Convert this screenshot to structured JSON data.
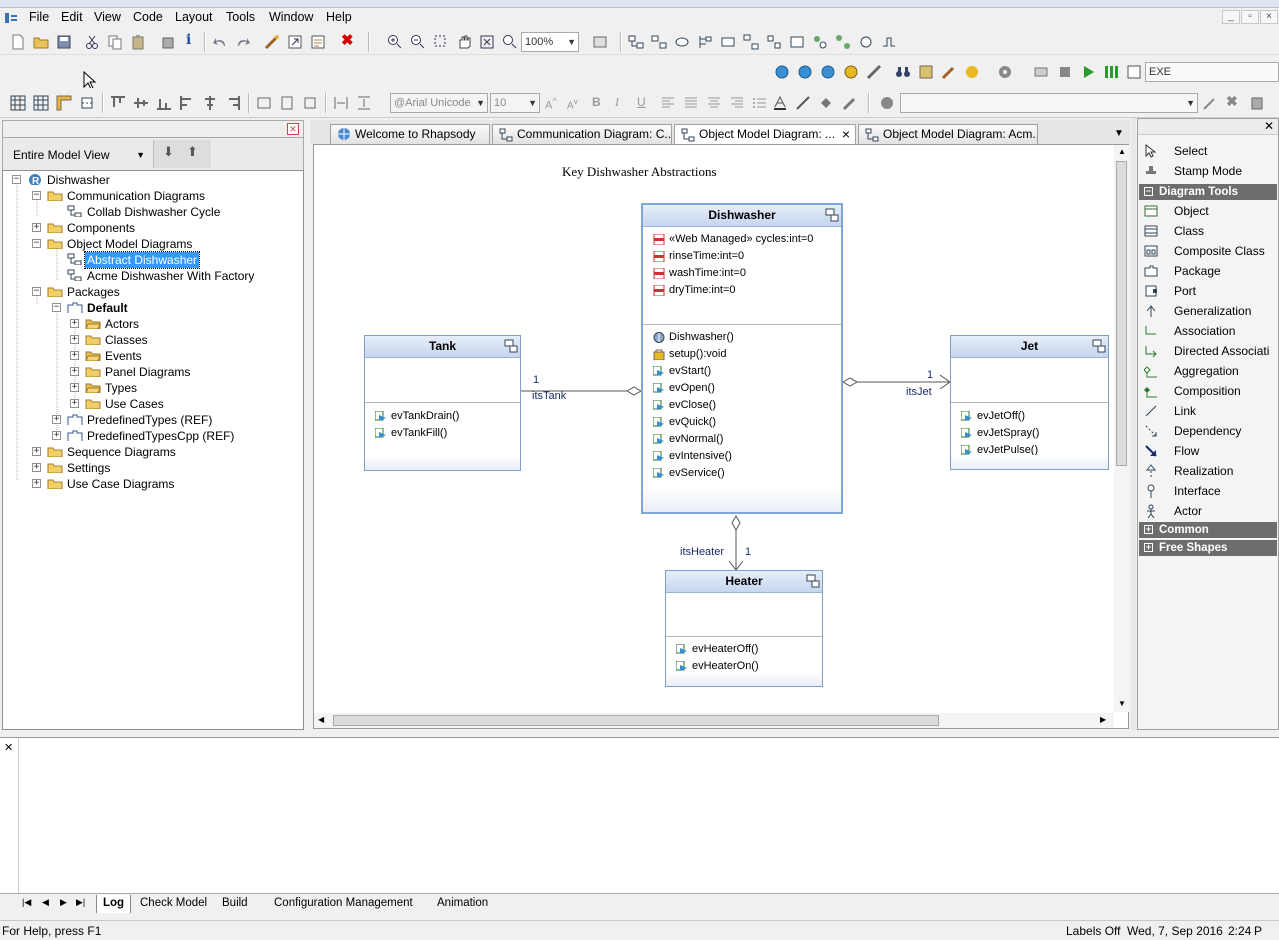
{
  "window": {
    "controls": [
      "_",
      "▫",
      "×"
    ]
  },
  "menu": [
    "File",
    "Edit",
    "View",
    "Code",
    "Layout",
    "Tools",
    "Window",
    "Help"
  ],
  "toolbar": {
    "zoom": "100%",
    "font": "@Arial Unicode",
    "font_size": "10",
    "config": "EXE"
  },
  "browser": {
    "view_selector": "Entire Model View",
    "tree": [
      {
        "label": "Dishwasher",
        "level": 0,
        "type": "root",
        "expanded": true
      },
      {
        "label": "Communication Diagrams",
        "level": 1,
        "type": "folder",
        "expanded": true
      },
      {
        "label": "Collab Dishwasher Cycle",
        "level": 2,
        "type": "diagram"
      },
      {
        "label": "Components",
        "level": 1,
        "type": "folder",
        "expanded": false
      },
      {
        "label": "Object Model Diagrams",
        "level": 1,
        "type": "folder",
        "expanded": true
      },
      {
        "label": "Abstract Dishwasher",
        "level": 2,
        "type": "diagram",
        "selected": true
      },
      {
        "label": "Acme Dishwasher With Factory",
        "level": 2,
        "type": "diagram"
      },
      {
        "label": "Packages",
        "level": 1,
        "type": "folder",
        "expanded": true
      },
      {
        "label": "Default",
        "level": 2,
        "type": "package",
        "expanded": true,
        "bold": true
      },
      {
        "label": "Actors",
        "level": 3,
        "type": "folder-open",
        "expanded": false
      },
      {
        "label": "Classes",
        "level": 3,
        "type": "folder",
        "expanded": false
      },
      {
        "label": "Events",
        "level": 3,
        "type": "folder-open",
        "expanded": false
      },
      {
        "label": "Panel Diagrams",
        "level": 3,
        "type": "folder",
        "expanded": false
      },
      {
        "label": "Types",
        "level": 3,
        "type": "folder-open",
        "expanded": false
      },
      {
        "label": "Use Cases",
        "level": 3,
        "type": "folder",
        "expanded": false
      },
      {
        "label": "PredefinedTypes (REF)",
        "level": 2,
        "type": "package",
        "expanded": false
      },
      {
        "label": "PredefinedTypesCpp (REF)",
        "level": 2,
        "type": "package",
        "expanded": false
      },
      {
        "label": "Sequence Diagrams",
        "level": 1,
        "type": "folder",
        "expanded": false
      },
      {
        "label": "Settings",
        "level": 1,
        "type": "folder",
        "expanded": false
      },
      {
        "label": "Use Case Diagrams",
        "level": 1,
        "type": "folder",
        "expanded": false
      }
    ]
  },
  "tabs": [
    {
      "label": "Welcome to Rhapsody",
      "active": false
    },
    {
      "label": "Communication Diagram: C...",
      "active": false
    },
    {
      "label": "Object Model Diagram: ...",
      "active": true,
      "close": "×"
    },
    {
      "label": "Object Model Diagram: Acm...",
      "active": false
    }
  ],
  "diagram": {
    "title": "Key Dishwasher Abstractions",
    "classes": {
      "dishwasher": {
        "name": "Dishwasher",
        "attributes": [
          "«Web Managed» cycles:int=0",
          "rinseTime:int=0",
          "washTime:int=0",
          "dryTime:int=0"
        ],
        "operations": [
          "Dishwasher()",
          "setup():void",
          "evStart()",
          "evOpen()",
          "evClose()",
          "evQuick()",
          "evNormal()",
          "evIntensive()",
          "evService()"
        ]
      },
      "tank": {
        "name": "Tank",
        "operations": [
          "evTankDrain()",
          "evTankFill()"
        ]
      },
      "jet": {
        "name": "Jet",
        "operations": [
          "evJetOff()",
          "evJetSpray()",
          "evJetPulse()"
        ]
      },
      "heater": {
        "name": "Heater",
        "operations": [
          "evHeaterOff()",
          "evHeaterOn()"
        ]
      }
    },
    "links": {
      "tank": {
        "mult": "1",
        "role": "itsTank"
      },
      "jet": {
        "mult": "1",
        "role": "itsJet"
      },
      "heater": {
        "mult": "1",
        "role": "itsHeater"
      }
    }
  },
  "palette": {
    "items": [
      "Select",
      "Stamp Mode"
    ],
    "sections": [
      {
        "title": "Diagram Tools",
        "expanded": true,
        "items": [
          "Object",
          "Class",
          "Composite Class",
          "Package",
          "Port",
          "Generalization",
          "Association",
          "Directed Associati",
          "Aggregation",
          "Composition",
          "Link",
          "Dependency",
          "Flow",
          "Realization",
          "Interface",
          "Actor"
        ]
      },
      {
        "title": "Common",
        "expanded": false
      },
      {
        "title": "Free Shapes",
        "expanded": false
      }
    ]
  },
  "output": {
    "tabs": [
      "Log",
      "Check Model",
      "Build",
      "Configuration Management",
      "Animation"
    ],
    "active": "Log"
  },
  "status": {
    "help": "For Help, press F1",
    "labels": "Labels Off",
    "date": "Wed, 7, Sep 2016",
    "time": "2:24",
    "mode": "P"
  }
}
